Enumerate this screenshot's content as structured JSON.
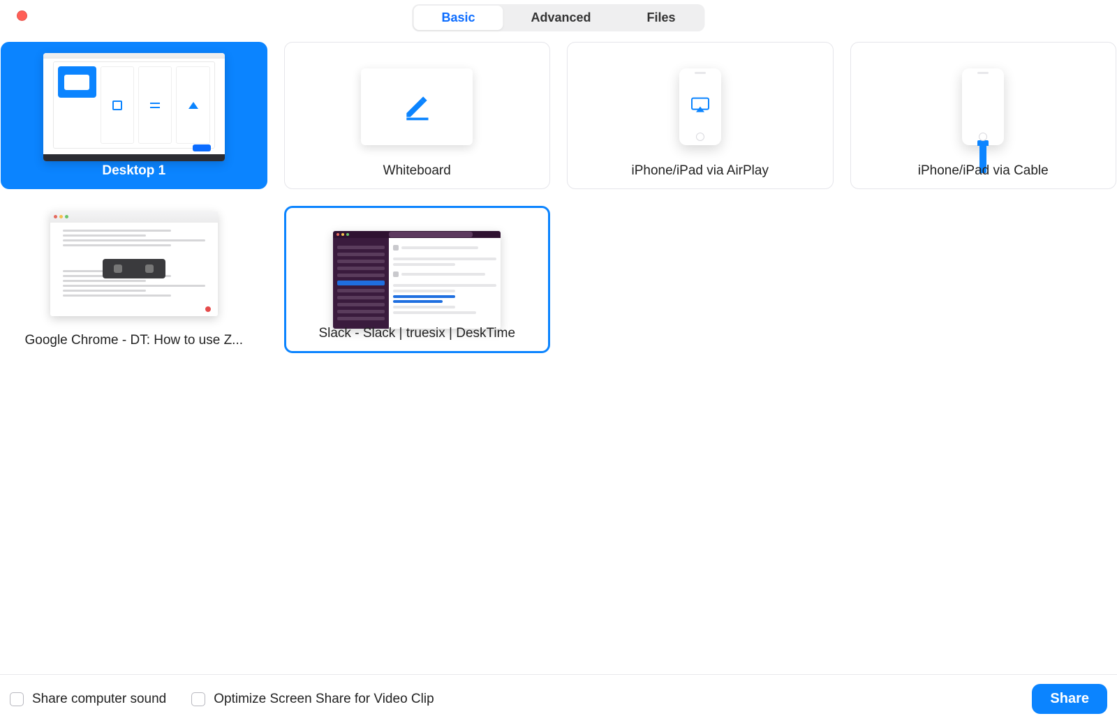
{
  "tabs": {
    "basic": "Basic",
    "advanced": "Advanced",
    "files": "Files",
    "active": "basic"
  },
  "options": {
    "desktop1": {
      "label": "Desktop 1"
    },
    "whiteboard": {
      "label": "Whiteboard"
    },
    "airplay": {
      "label": "iPhone/iPad via AirPlay"
    },
    "cable": {
      "label": "iPhone/iPad via Cable"
    },
    "chrome": {
      "label": "Google Chrome - DT: How to use Z..."
    },
    "slack": {
      "label": "Slack - Slack | truesix | DeskTime"
    }
  },
  "bottom": {
    "share_sound": "Share computer sound",
    "optimize_clip": "Optimize Screen Share for Video Clip",
    "share_button": "Share"
  },
  "colors": {
    "accent": "#0b84ff"
  }
}
